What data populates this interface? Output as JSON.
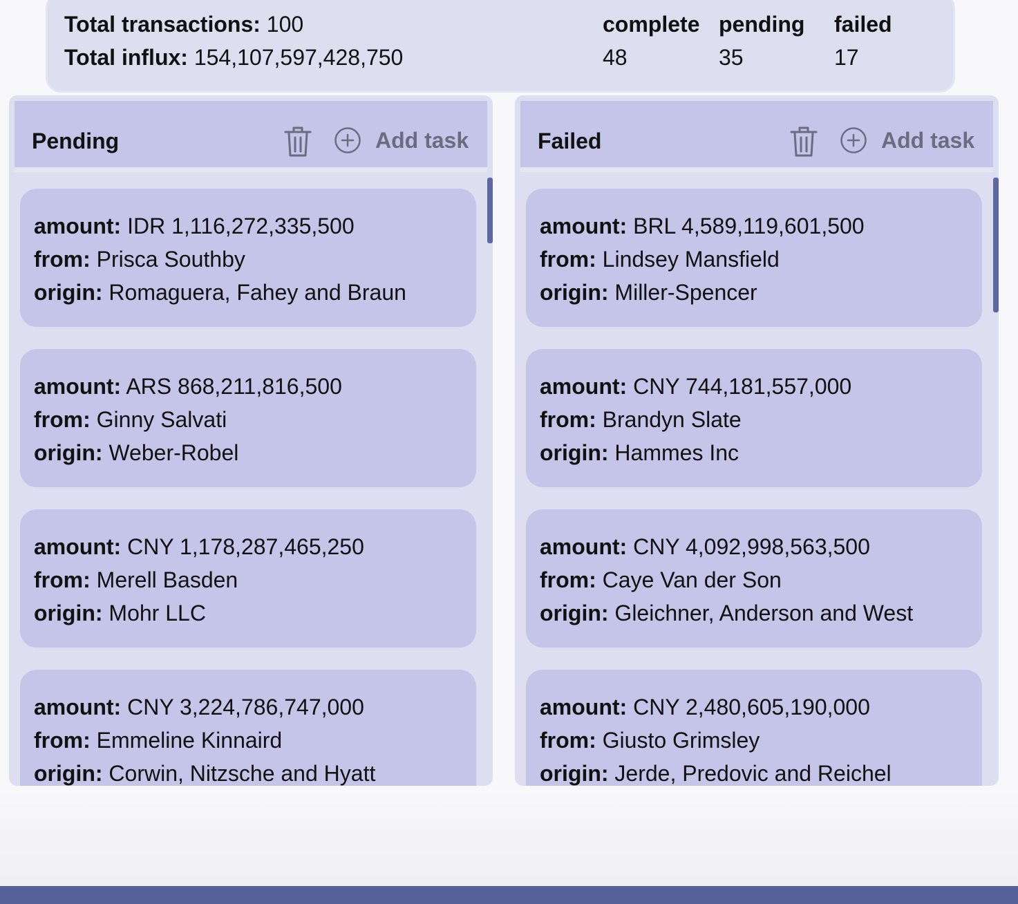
{
  "summary": {
    "total_transactions_label": "Total transactions:",
    "total_transactions_value": "100",
    "total_influx_label": "Total influx:",
    "total_influx_value": "154,107,597,428,750",
    "stats": [
      {
        "label": "complete",
        "value": "48"
      },
      {
        "label": "pending",
        "value": "35"
      },
      {
        "label": "failed",
        "value": "17"
      }
    ]
  },
  "field_labels": {
    "amount": "amount:",
    "from": "from:",
    "origin": "origin:"
  },
  "columns": [
    {
      "title": "Pending",
      "add_label": "Add task",
      "icons": {
        "delete": "trash-icon",
        "add": "plus-circle-icon"
      },
      "cards": [
        {
          "amount": "IDR 1,116,272,335,500",
          "from": "Prisca Southby",
          "origin": "Romaguera, Fahey and Braun"
        },
        {
          "amount": "ARS 868,211,816,500",
          "from": "Ginny Salvati",
          "origin": "Weber-Robel"
        },
        {
          "amount": "CNY 1,178,287,465,250",
          "from": "Merell Basden",
          "origin": "Mohr LLC"
        },
        {
          "amount": "CNY 3,224,786,747,000",
          "from": "Emmeline Kinnaird",
          "origin": "Corwin, Nitzsche and Hyatt"
        }
      ]
    },
    {
      "title": "Failed",
      "add_label": "Add task",
      "icons": {
        "delete": "trash-icon",
        "add": "plus-circle-icon"
      },
      "cards": [
        {
          "amount": "BRL 4,589,119,601,500",
          "from": "Lindsey Mansfield",
          "origin": "Miller-Spencer"
        },
        {
          "amount": "CNY 744,181,557,000",
          "from": "Brandyn Slate",
          "origin": "Hammes Inc"
        },
        {
          "amount": "CNY 4,092,998,563,500",
          "from": "Caye Van der Son",
          "origin": "Gleichner, Anderson and West"
        },
        {
          "amount": "CNY 2,480,605,190,000",
          "from": "Giusto Grimsley",
          "origin": "Jerde, Predovic and Reichel"
        }
      ]
    }
  ],
  "colors": {
    "accent": "#56619a",
    "card": "#c5c5e9",
    "panel": "#dddff0"
  }
}
